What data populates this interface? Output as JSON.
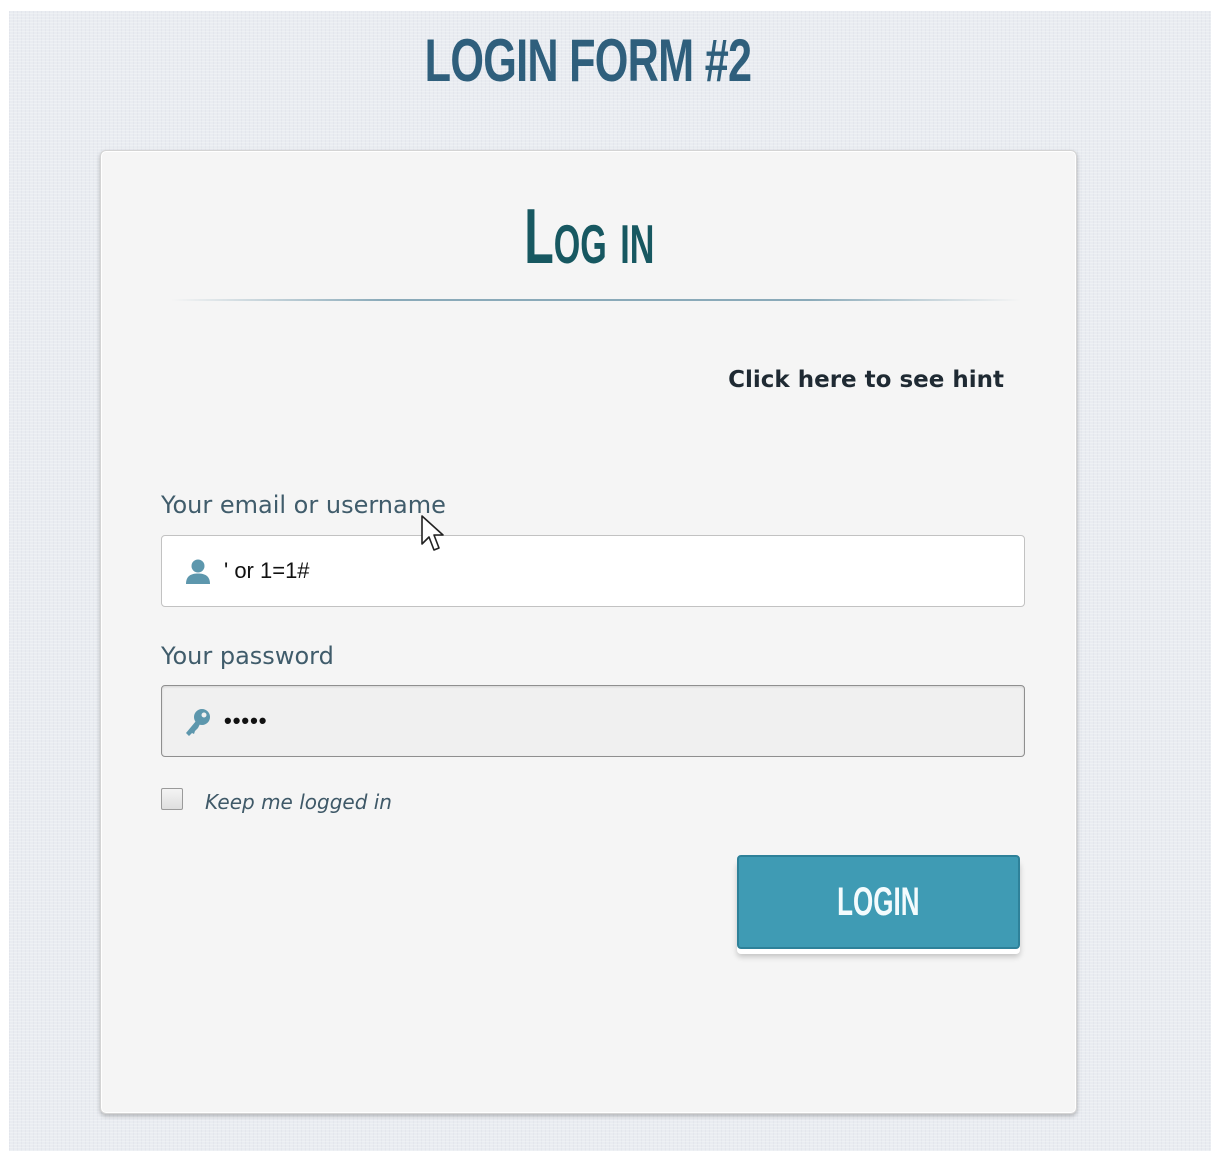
{
  "page": {
    "title": "LOGIN FORM #2"
  },
  "form": {
    "heading": "Log in",
    "hint_link": "Click here to see hint",
    "username": {
      "label": "Your email or username",
      "value": "' or 1=1#",
      "icon": "user-icon"
    },
    "password": {
      "label": "Your password",
      "value": "•••••",
      "icon": "key-icon"
    },
    "remember": {
      "label": "Keep me logged in",
      "checked": false
    },
    "submit_label": "LOGIN"
  },
  "colors": {
    "accent": "#3f9bb4",
    "heading": "#175861",
    "title": "#2f5f7c",
    "background": "#e9ecf1",
    "card": "#f5f5f5"
  }
}
